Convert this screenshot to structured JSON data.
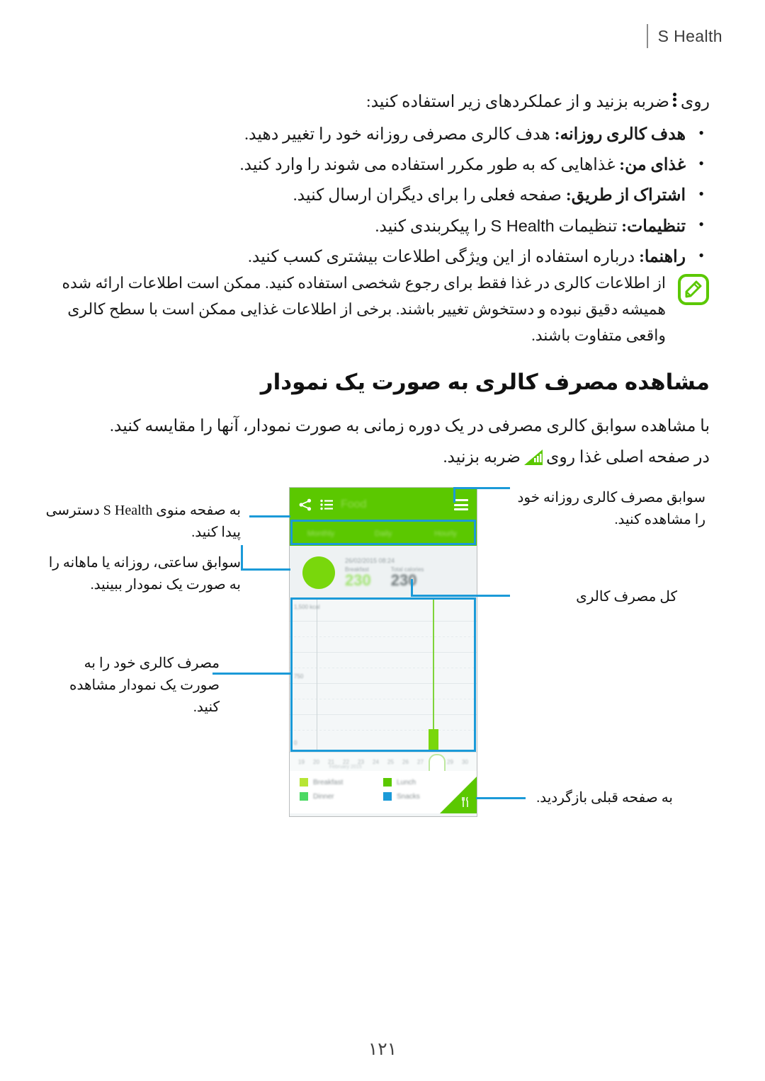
{
  "header": {
    "title": "S Health"
  },
  "content": {
    "intro_before": "روی",
    "intro_after": "ضربه بزنید و از عملکردهای زیر استفاده کنید:",
    "bullets": [
      {
        "term": "هدف کالری روزانه:",
        "desc": "هدف کالری مصرفی روزانه خود را تغییر دهید."
      },
      {
        "term": "غذای من:",
        "desc": "غذاهایی که به طور مکرر استفاده می شوند را وارد کنید."
      },
      {
        "term": "اشتراک از طریق:",
        "desc": "صفحه فعلی را برای دیگران ارسال کنید."
      },
      {
        "term": "تنظیمات:",
        "desc_before": "تنظیمات",
        "ltr_word": "S Health",
        "desc_after": "را پیکربندی کنید."
      },
      {
        "term": "راهنما:",
        "desc": "درباره استفاده از این ویژگی اطلاعات بیشتری کسب کنید."
      }
    ],
    "note": "از اطلاعات کالری در غذا فقط برای رجوع شخصی استفاده کنید. ممکن است اطلاعات ارائه شده همیشه دقیق نبوده و دستخوش تغییر باشند. برخی از اطلاعات غذایی ممکن است با سطح کالری واقعی متفاوت باشند.",
    "note_bold_word": "غذا",
    "heading": "مشاهده مصرف کالری به صورت یک نمودار",
    "section_line1": "با مشاهده سوابق کالری مصرفی در یک دوره زمانی به صورت نمودار، آنها را مقایسه کنید.",
    "section_line2_before": "در صفحه اصلی غذا روی",
    "section_line2_after": "ضربه بزنید."
  },
  "figure": {
    "app": {
      "title": "Food",
      "menu_icon": "hamburger-icon",
      "list_icon": "list-icon",
      "share_icon": "share-icon",
      "tabs": [
        "Hourly",
        "Daily",
        "Monthly"
      ],
      "summary": {
        "date": "26/02/2015 08:24",
        "col1_label": "Breakfast",
        "col1_value": "230",
        "col2_label": "Total calories",
        "col2_value": "230"
      },
      "legend": [
        {
          "label": "Breakfast",
          "color": "#b7e534"
        },
        {
          "label": "Lunch",
          "color": "#5BC800"
        },
        {
          "label": "Dinner",
          "color": "#4cd964"
        },
        {
          "label": "Snacks",
          "color": "#1B9AD8"
        }
      ],
      "y_labels": [
        "1,500 kcal",
        "750",
        "0"
      ],
      "x_labels": [
        "19",
        "20",
        "21",
        "22",
        "23",
        "24",
        "25",
        "26",
        "27",
        "28",
        "29",
        "30"
      ],
      "x_caption": "February 2015",
      "fab_icon": "cutlery-icon"
    },
    "callouts": {
      "left_top": "به صفحه منوی S Health دسترسی پیدا کنید.",
      "left_mid": "سوابق ساعتی، روزانه یا ماهانه را به صورت یک نمودار ببینید.",
      "left_bottom": "مصرف کالری خود را به صورت یک نمودار مشاهده کنید.",
      "right_top": "سوابق مصرف کالری روزانه خود را مشاهده کنید.",
      "right_mid": "کل مصرف کالری",
      "right_bottom": "به صفحه قبلی بازگردید."
    }
  },
  "footer": {
    "page_number": "۱۲۱"
  },
  "colors": {
    "brand_green": "#5BC800",
    "highlight_blue": "#1B9AD8",
    "note_green": "#5BC800"
  }
}
